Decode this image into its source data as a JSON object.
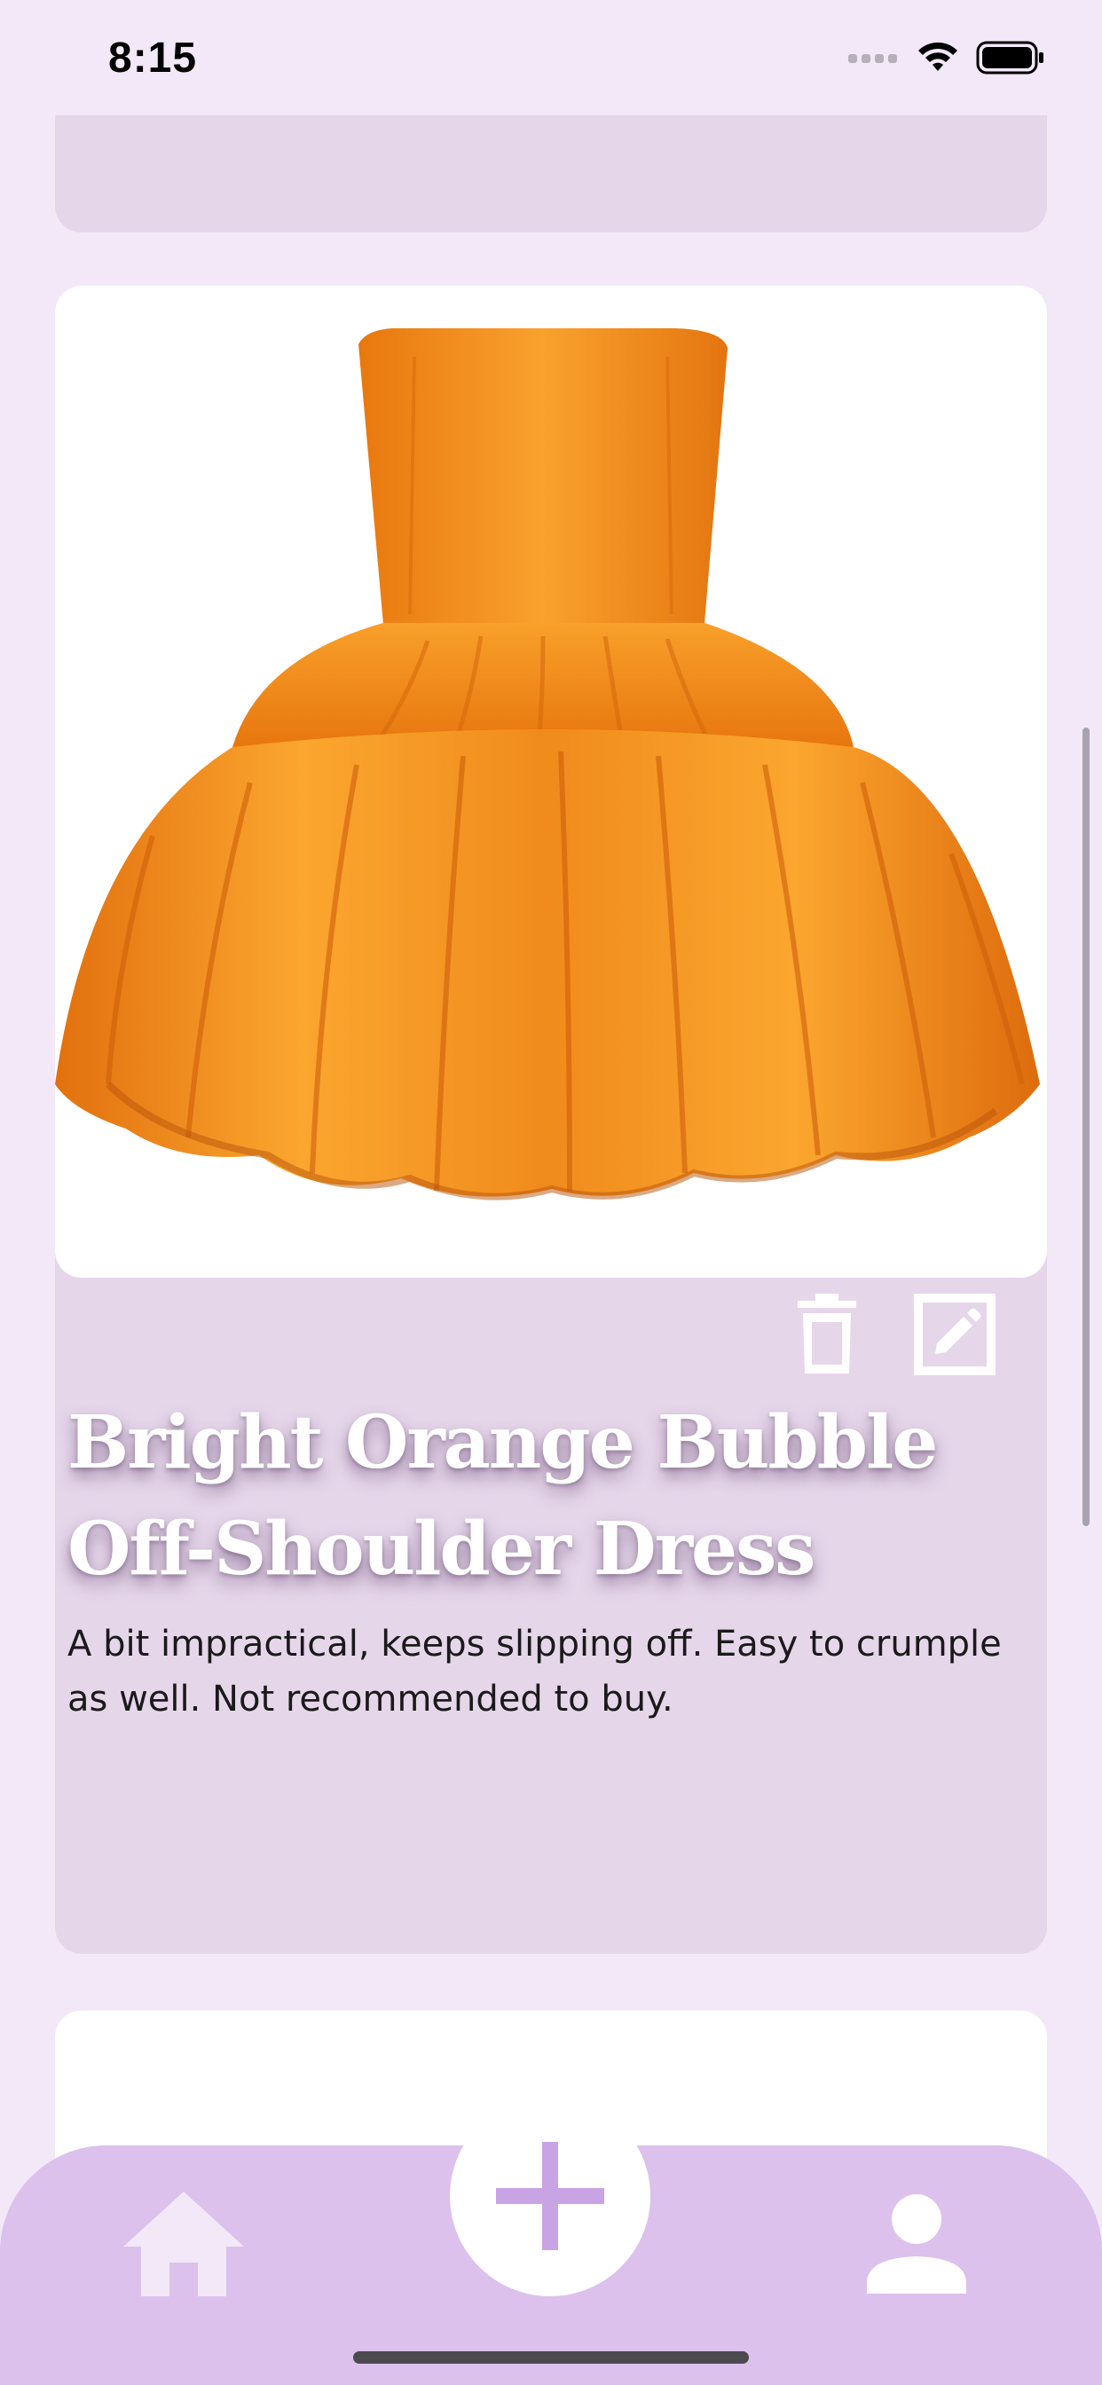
{
  "status_bar": {
    "time": "8:15"
  },
  "card": {
    "title": "Bright Orange Bubble Off-Shoulder Dress",
    "description": "A bit impractical, keeps slipping off. Easy to crumple as well. Not recommended to buy.",
    "image_icon": "orange-dress-image",
    "actions": {
      "delete_icon": "trash-icon",
      "edit_icon": "edit-icon"
    }
  },
  "nav": {
    "home_icon": "home-icon",
    "add_icon": "plus-icon",
    "profile_icon": "person-icon"
  },
  "colors": {
    "background": "#f3e8f8",
    "card": "#e6d6ea",
    "nav": "#dbc1ec",
    "accent": "#c9a4e4",
    "dress": "#f7921e"
  }
}
